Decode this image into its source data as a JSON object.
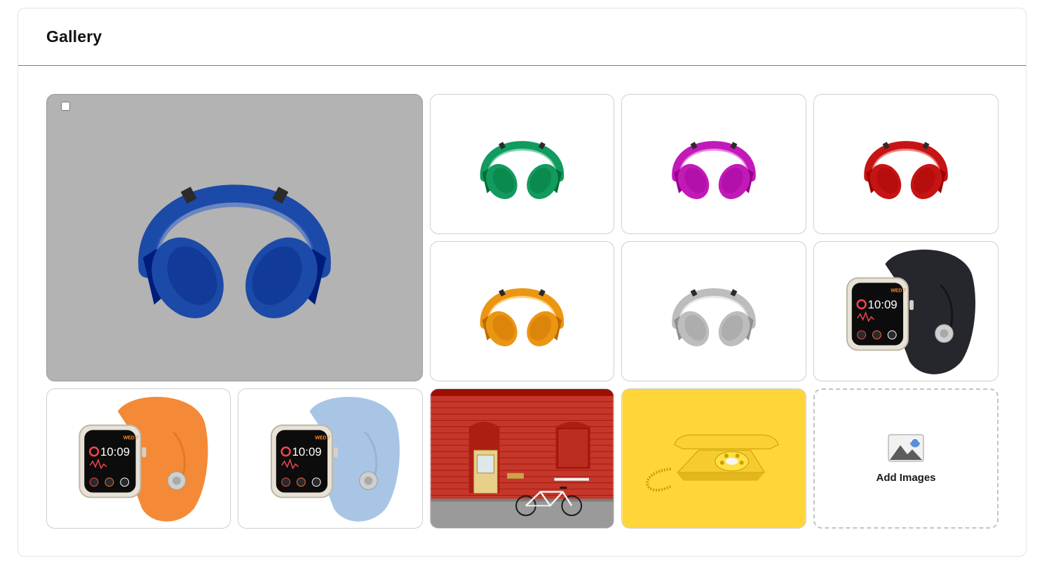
{
  "gallery": {
    "title": "Gallery",
    "featured": {
      "type": "headphones",
      "color": "#1c4aa8",
      "background": "#b3b3b3",
      "selected": false
    },
    "items": [
      {
        "type": "headphones",
        "color": "#129a5f"
      },
      {
        "type": "headphones",
        "color": "#c21ab8"
      },
      {
        "type": "headphones",
        "color": "#c61414"
      },
      {
        "type": "headphones",
        "color": "#eb9612"
      },
      {
        "type": "headphones",
        "color": "#bdbdbd"
      },
      {
        "type": "watch",
        "color": "#25272d",
        "time": "10:09",
        "day": "WED 7"
      },
      {
        "type": "watch",
        "color": "#f48a37",
        "time": "10:09",
        "day": "WED 7"
      },
      {
        "type": "watch",
        "color": "#a9c5e6",
        "time": "10:09",
        "day": "WED 7"
      },
      {
        "type": "brick-wall",
        "color": "#c4372a"
      },
      {
        "type": "telephone",
        "color": "#ffd53a"
      }
    ],
    "add_tile": {
      "label": "Add Images",
      "icon": "image-upload-icon"
    }
  }
}
